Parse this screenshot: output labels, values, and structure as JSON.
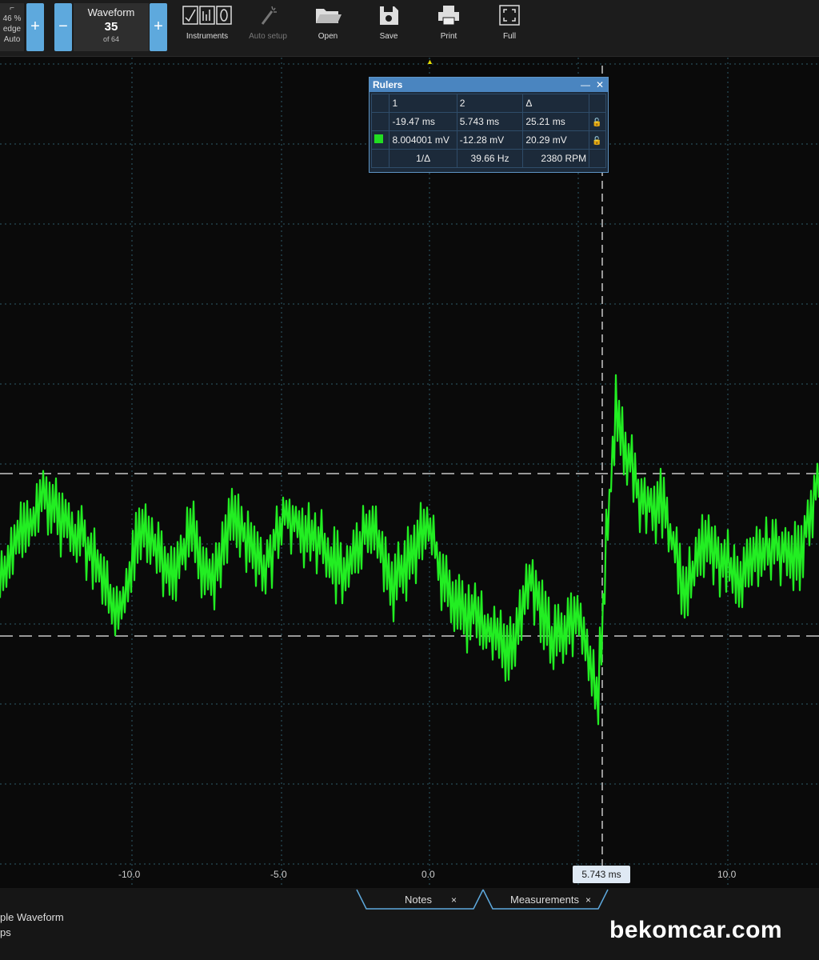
{
  "toolbar": {
    "trigger": {
      "percent": "46 %",
      "mode": "edge",
      "auto": "Auto"
    },
    "plus": "+",
    "minus": "−",
    "waveform": {
      "title": "Waveform",
      "number": "35",
      "of": "of 64"
    },
    "buttons": {
      "instruments": "Instruments",
      "autosetup": "Auto setup",
      "open": "Open",
      "save": "Save",
      "print": "Print",
      "full": "Full"
    }
  },
  "rulers": {
    "title": "Rulers",
    "minimize": "—",
    "close": "✕",
    "headers": [
      "1",
      "2",
      "Δ"
    ],
    "row_time": [
      "-19.47 ms",
      "5.743 ms",
      "25.21 ms"
    ],
    "row_volt": [
      "8.004001 mV",
      "-12.28 mV",
      "20.29 mV"
    ],
    "freq": {
      "label": "1/Δ",
      "hz": "39.66 Hz",
      "rpm": "2380 RPM"
    }
  },
  "plot": {
    "x_ticks": [
      "-10.0",
      "-5.0",
      "0.0",
      "10.0"
    ],
    "cursor_label": "5.743 ms",
    "colors": {
      "trace": "#22ee22",
      "grid": "#2f5a6a",
      "ruler": "#c8c8c8"
    },
    "trigger_marker": "▲"
  },
  "tabs": {
    "notes": "Notes",
    "measurements": "Measurements",
    "close": "×"
  },
  "bottom": {
    "line1": "ple Waveform",
    "line2": "ps"
  },
  "watermark": "bekomcar.com"
}
